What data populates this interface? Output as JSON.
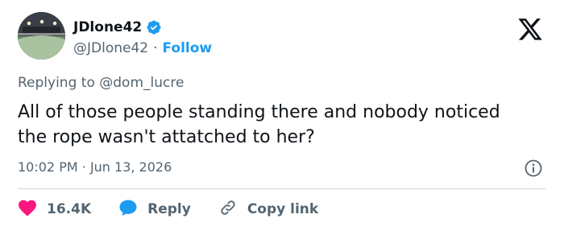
{
  "author": {
    "display_name": "JDlone42",
    "handle": "@JDlone42",
    "separator": "·",
    "follow_label": "Follow"
  },
  "reply": {
    "prefix": "Replying to",
    "mention": "@dom_lucre"
  },
  "tweet": {
    "text": "All of those people standing there and nobody noticed the rope wasn't attatched to her?",
    "time": "10:02 PM",
    "separator": "·",
    "date": "Jun 13, 2026"
  },
  "actions": {
    "likes_count": "16.4K",
    "reply_label": "Reply",
    "copy_label": "Copy link"
  },
  "icons": {
    "verified": "verified-badge-icon",
    "brand": "x-logo-icon",
    "info": "info-icon",
    "like": "heart-icon",
    "reply": "reply-bubble-icon",
    "copy": "link-icon"
  },
  "colors": {
    "text": "#0f1419",
    "secondary": "#536471",
    "accent": "#1d9bf0",
    "like": "#f91880",
    "divider": "#cfd9de"
  }
}
